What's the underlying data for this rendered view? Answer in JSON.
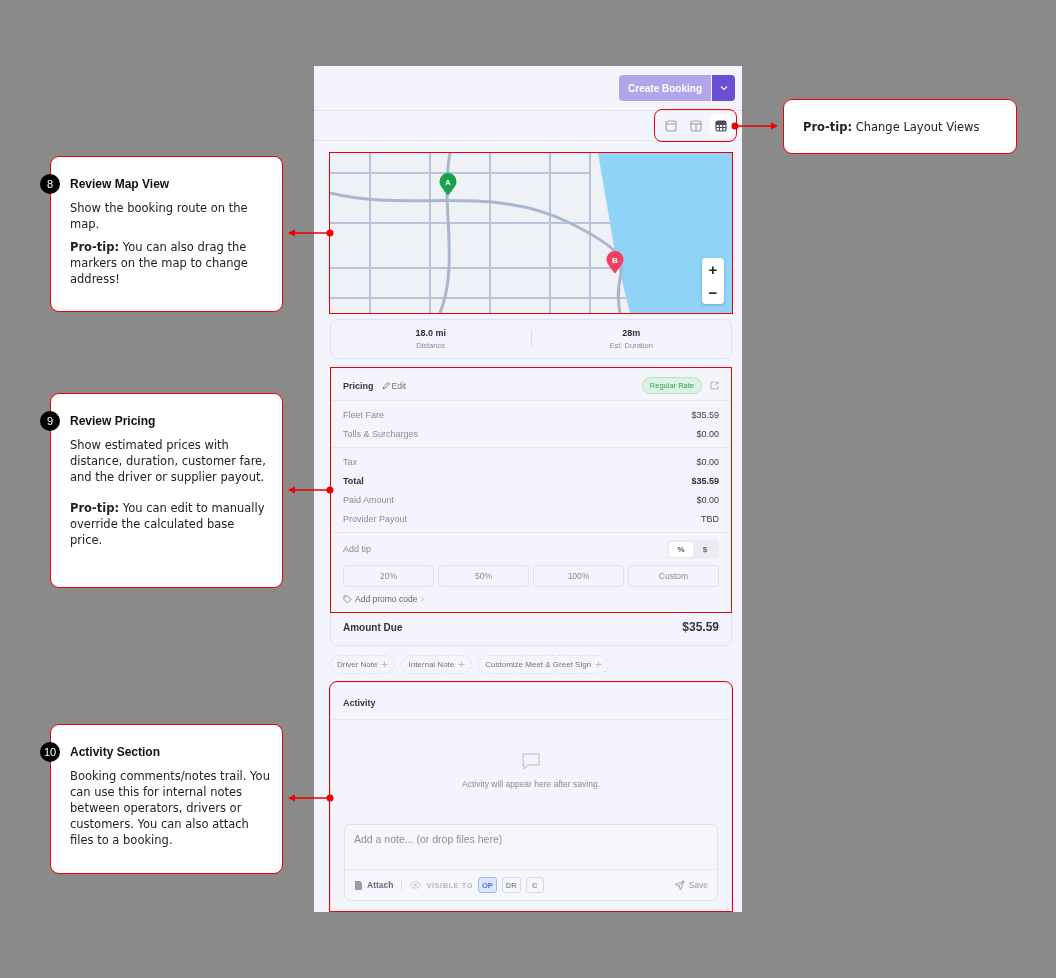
{
  "header": {
    "create_button": "Create Booking"
  },
  "layout_views": [
    {
      "kind": "single",
      "selected": false
    },
    {
      "kind": "split",
      "selected": false
    },
    {
      "kind": "grid",
      "selected": true
    }
  ],
  "map": {
    "markers": [
      {
        "label": "A",
        "color": "#16a34a"
      },
      {
        "label": "B",
        "color": "#f43f5e"
      }
    ],
    "zoom_controls": [
      "+",
      "−"
    ]
  },
  "trip_stats": [
    {
      "value": "18.0 mi",
      "label": "Distance"
    },
    {
      "value": "28m",
      "label": "Est. Duration"
    }
  ],
  "pricing": {
    "title": "Pricing",
    "edit": "Edit",
    "rate_badge": "Regular Rate",
    "groups": [
      [
        {
          "label": "Fleet Fare",
          "value": "$35.59",
          "bold": false
        },
        {
          "label": "Tolls & Surcharges",
          "value": "$0.00",
          "bold": false
        }
      ],
      [
        {
          "label": "Tax",
          "value": "$0.00",
          "bold": false
        },
        {
          "label": "Total",
          "value": "$35.59",
          "bold": true
        },
        {
          "label": "Paid Amount",
          "value": "$0.00",
          "bold": false
        },
        {
          "label": "Provider Payout",
          "value": "TBD",
          "bold": false
        }
      ]
    ],
    "tip": {
      "label": "Add tip",
      "modes": [
        {
          "label": "%",
          "selected": true
        },
        {
          "label": "$",
          "selected": false
        }
      ],
      "options": [
        "20%",
        "50%",
        "100%",
        "Custom"
      ]
    },
    "promo": "Add promo code"
  },
  "amount_due": {
    "label": "Amount Due",
    "value": "$35.59"
  },
  "note_chips": [
    "Driver Note",
    "Internal Note",
    "Customize Meet & Greet Sign"
  ],
  "activity": {
    "title": "Activity",
    "empty_text": "Activity will appear here after saving.",
    "note_placeholder": "Add a note... (or drop files here)",
    "attach": "Attach",
    "visible_to": "VISIBLE TO",
    "audiences": [
      {
        "label": "OP",
        "selected": true
      },
      {
        "label": "DR",
        "selected": false
      },
      {
        "label": "C",
        "selected": false
      }
    ],
    "save": "Save"
  },
  "callouts": [
    {
      "paragraphs": [
        "**Pro-tip:** Change Layout Views"
      ]
    },
    {
      "number": "8",
      "title": "Review Map View",
      "paragraphs": [
        "Show the booking route on the map.",
        "**Pro-tip:** You can also drag the markers on the map to change address!"
      ]
    },
    {
      "number": "9",
      "title": "Review Pricing",
      "paragraphs": [
        "Show estimated prices with distance, duration, customer fare, and the driver or supplier payout.",
        "**Pro-tip:** You can edit to manually override the calculated base price."
      ]
    },
    {
      "number": "10",
      "title": "Activity Section",
      "paragraphs": [
        "Booking comments/notes trail. You can use this for internal notes between operators, drivers or customers. You can also attach files to a booking."
      ]
    }
  ]
}
